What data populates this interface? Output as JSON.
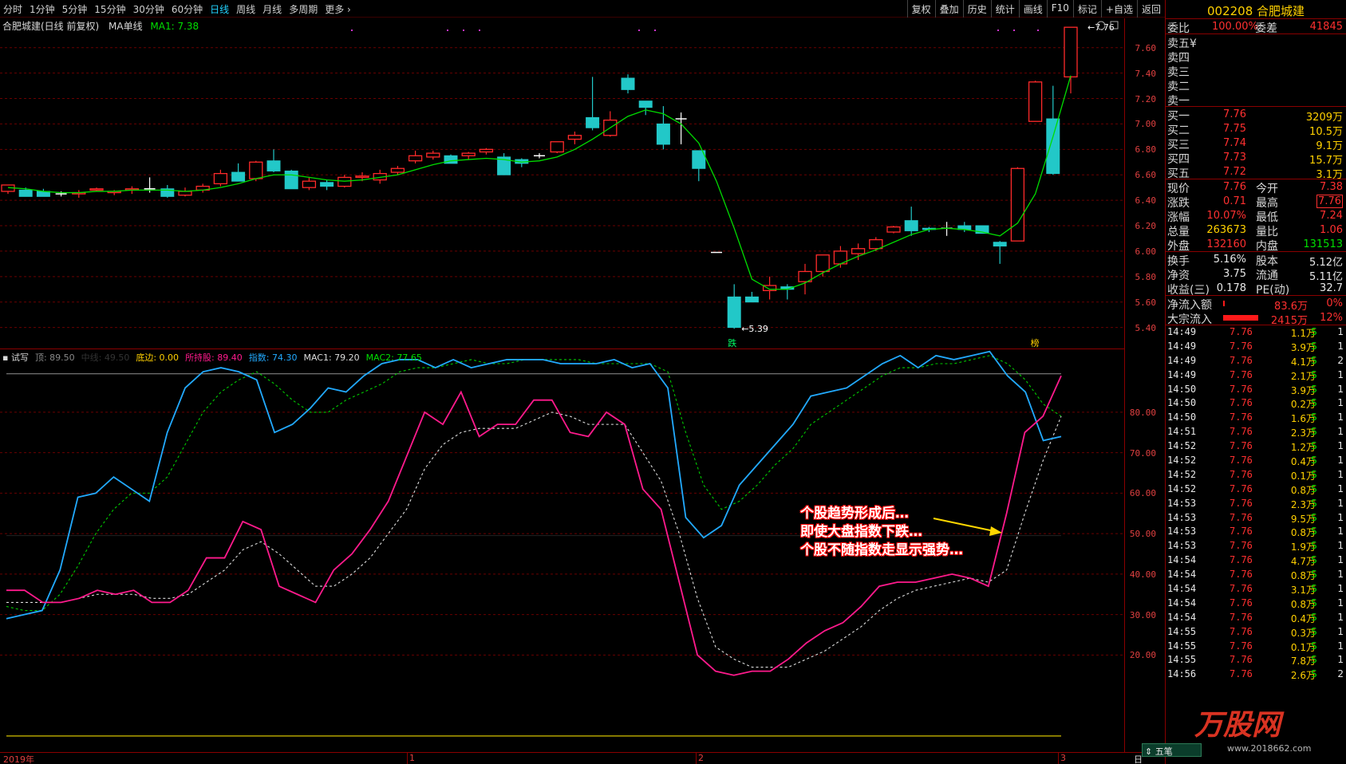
{
  "toolbar": {
    "periods": [
      "分时",
      "1分钟",
      "5分钟",
      "15分钟",
      "30分钟",
      "60分钟",
      "日线",
      "周线",
      "月线",
      "多周期",
      "更多"
    ],
    "active_period": "日线",
    "tools": [
      "复权",
      "叠加",
      "历史",
      "统计",
      "画线",
      "F10",
      "标记",
      "+自选",
      "返回"
    ]
  },
  "main_chart": {
    "title": "合肥城建(日线 前复权)",
    "indicator_name": "MA单线",
    "ma_label": "MA1: 7.38",
    "y_ticks": [
      "7.60",
      "7.40",
      "7.20",
      "7.00",
      "6.80",
      "6.60",
      "6.40",
      "6.20",
      "6.00",
      "5.80",
      "5.60",
      "5.40"
    ],
    "high_marker": "7.76",
    "low_marker": "5.39",
    "tag_die": "跌",
    "tag_bang": "榜"
  },
  "chart_data": {
    "type": "candlestick",
    "ylim": [
      5.36,
      7.78
    ],
    "ohlc": [
      [
        6.47,
        6.52,
        6.45,
        6.52
      ],
      [
        6.48,
        6.5,
        6.43,
        6.43
      ],
      [
        6.47,
        6.49,
        6.43,
        6.43
      ],
      [
        6.45,
        6.47,
        6.43,
        6.45
      ],
      [
        6.45,
        6.48,
        6.42,
        6.46
      ],
      [
        6.48,
        6.5,
        6.47,
        6.49
      ],
      [
        6.46,
        6.48,
        6.44,
        6.47
      ],
      [
        6.48,
        6.51,
        6.45,
        6.49
      ],
      [
        6.49,
        6.58,
        6.46,
        6.49
      ],
      [
        6.49,
        6.52,
        6.42,
        6.43
      ],
      [
        6.44,
        6.5,
        6.43,
        6.47
      ],
      [
        6.48,
        6.53,
        6.46,
        6.51
      ],
      [
        6.53,
        6.64,
        6.51,
        6.61
      ],
      [
        6.62,
        6.69,
        6.55,
        6.55
      ],
      [
        6.57,
        6.71,
        6.55,
        6.7
      ],
      [
        6.71,
        6.8,
        6.62,
        6.63
      ],
      [
        6.63,
        6.64,
        6.49,
        6.49
      ],
      [
        6.5,
        6.58,
        6.48,
        6.55
      ],
      [
        6.54,
        6.56,
        6.48,
        6.51
      ],
      [
        6.51,
        6.6,
        6.5,
        6.58
      ],
      [
        6.58,
        6.62,
        6.55,
        6.59
      ],
      [
        6.56,
        6.64,
        6.53,
        6.61
      ],
      [
        6.62,
        6.67,
        6.6,
        6.65
      ],
      [
        6.71,
        6.79,
        6.69,
        6.75
      ],
      [
        6.74,
        6.79,
        6.72,
        6.77
      ],
      [
        6.75,
        6.76,
        6.69,
        6.69
      ],
      [
        6.75,
        6.78,
        6.72,
        6.77
      ],
      [
        6.78,
        6.81,
        6.76,
        6.8
      ],
      [
        6.74,
        6.77,
        6.6,
        6.6
      ],
      [
        6.72,
        6.73,
        6.66,
        6.69
      ],
      [
        6.75,
        6.77,
        6.73,
        6.75
      ],
      [
        6.78,
        6.86,
        6.77,
        6.86
      ],
      [
        6.88,
        6.94,
        6.84,
        6.91
      ],
      [
        7.05,
        7.37,
        6.95,
        6.97
      ],
      [
        6.91,
        7.1,
        6.9,
        7.03
      ],
      [
        7.36,
        7.39,
        7.24,
        7.27
      ],
      [
        7.18,
        7.17,
        7.07,
        7.13
      ],
      [
        7.0,
        7.14,
        6.8,
        6.84
      ],
      [
        7.04,
        7.09,
        6.84,
        7.04
      ],
      [
        6.79,
        6.79,
        6.55,
        6.65
      ],
      [
        5.99,
        5.99,
        5.99,
        5.99
      ],
      [
        5.64,
        5.74,
        5.39,
        5.4
      ],
      [
        5.64,
        5.68,
        5.61,
        5.6
      ],
      [
        5.69,
        5.8,
        5.62,
        5.73
      ],
      [
        5.72,
        5.74,
        5.62,
        5.7
      ],
      [
        5.76,
        5.9,
        5.66,
        5.84
      ],
      [
        5.84,
        5.94,
        5.8,
        5.97
      ],
      [
        5.9,
        6.04,
        5.87,
        6.0
      ],
      [
        5.98,
        6.06,
        5.93,
        6.02
      ],
      [
        6.02,
        6.11,
        6.0,
        6.09
      ],
      [
        6.15,
        6.2,
        6.14,
        6.19
      ],
      [
        6.24,
        6.35,
        6.12,
        6.16
      ],
      [
        6.18,
        6.19,
        6.15,
        6.17
      ],
      [
        6.18,
        6.23,
        6.12,
        6.18
      ],
      [
        6.2,
        6.23,
        6.15,
        6.17
      ],
      [
        6.2,
        6.2,
        6.14,
        6.14
      ],
      [
        6.07,
        6.08,
        5.9,
        6.04
      ],
      [
        6.08,
        6.66,
        6.08,
        6.65
      ],
      [
        7.02,
        7.34,
        7.02,
        7.33
      ],
      [
        7.04,
        7.3,
        6.6,
        6.61
      ],
      [
        7.37,
        7.76,
        7.24,
        7.76
      ]
    ],
    "ma": [
      6.5,
      6.49,
      6.47,
      6.46,
      6.46,
      6.47,
      6.47,
      6.48,
      6.48,
      6.48,
      6.47,
      6.48,
      6.5,
      6.53,
      6.57,
      6.6,
      6.6,
      6.58,
      6.56,
      6.55,
      6.56,
      6.58,
      6.6,
      6.64,
      6.68,
      6.71,
      6.72,
      6.73,
      6.72,
      6.7,
      6.71,
      6.74,
      6.8,
      6.88,
      6.97,
      7.06,
      7.11,
      7.08,
      7.0,
      6.85,
      6.55,
      6.18,
      5.78,
      5.7,
      5.7,
      5.75,
      5.83,
      5.9,
      5.96,
      6.01,
      6.07,
      6.13,
      6.17,
      6.18,
      6.17,
      6.15,
      6.12,
      6.22,
      6.45,
      6.9,
      7.38
    ]
  },
  "indicator": {
    "name": "试写",
    "items": [
      {
        "label": "顶: 89.50",
        "color": "#888888"
      },
      {
        "label": "中线: 49.50",
        "color": "#333333"
      },
      {
        "label": "底边: 0.00",
        "color": "#ffd000"
      },
      {
        "label": "所持股: 89.40",
        "color": "#ff1a8c"
      },
      {
        "label": "指数: 74.30",
        "color": "#22aaff"
      },
      {
        "label": "MAC1: 79.20",
        "color": "#dddddd"
      },
      {
        "label": "MAC2: 77.65",
        "color": "#00e000"
      }
    ],
    "y_ticks": [
      "80.00",
      "70.00",
      "60.00",
      "50.00",
      "40.00",
      "30.00",
      "20.00"
    ],
    "ylim": [
      -2,
      92
    ],
    "series_stock": [
      36,
      36,
      33,
      33,
      34,
      36,
      35,
      36,
      33,
      33,
      36,
      44,
      44,
      53,
      51,
      37,
      35,
      33,
      41,
      45,
      51,
      58,
      69,
      80,
      77,
      85,
      74,
      77,
      77,
      83,
      83,
      75,
      74,
      80,
      77,
      61,
      56,
      38,
      20,
      16,
      15,
      16,
      16,
      19,
      23,
      26,
      28,
      32,
      37,
      38,
      38,
      39,
      40,
      39,
      37,
      55,
      75,
      79,
      89
    ],
    "series_stock_ma": [
      33,
      33,
      33,
      33,
      34,
      35,
      35,
      35,
      34,
      34,
      35,
      38,
      41,
      46,
      48,
      45,
      41,
      37,
      37,
      40,
      44,
      50,
      56,
      66,
      72,
      75,
      76,
      76,
      76,
      78,
      80,
      79,
      77,
      77,
      77,
      70,
      63,
      50,
      34,
      22,
      19,
      17,
      17,
      17,
      19,
      21,
      24,
      27,
      31,
      34,
      36,
      37,
      38,
      39,
      38,
      41,
      55,
      68,
      79
    ],
    "series_index": [
      29,
      30,
      31,
      41,
      59,
      60,
      64,
      61,
      58,
      75,
      86,
      90,
      91,
      90,
      88,
      75,
      77,
      81,
      86,
      85,
      89,
      92,
      93,
      93,
      91,
      93,
      91,
      92,
      93,
      93,
      93,
      92,
      92,
      92,
      93,
      91,
      92,
      86,
      54,
      49,
      52,
      62,
      67,
      72,
      77,
      84,
      85,
      86,
      89,
      92,
      94,
      91,
      94,
      93,
      94,
      95,
      89,
      85,
      73,
      74
    ],
    "series_index_ma": [
      32,
      31,
      31,
      35,
      42,
      50,
      56,
      60,
      60,
      64,
      72,
      80,
      85,
      88,
      90,
      87,
      83,
      80,
      80,
      83,
      85,
      87,
      90,
      91,
      91,
      92,
      93,
      92,
      92,
      93,
      93,
      93,
      93,
      92,
      92,
      92,
      92,
      90,
      75,
      62,
      56,
      58,
      62,
      67,
      71,
      77,
      80,
      83,
      86,
      89,
      91,
      91,
      92,
      92,
      93,
      94,
      92,
      88,
      82,
      79
    ],
    "annotation": [
      "个股趋势形成后…",
      "即使大盘指数下跌…",
      "个股不随指数走显示强势…"
    ]
  },
  "date_axis": {
    "labels": [
      "2019年",
      "1",
      "2",
      "3"
    ],
    "right_label": "日"
  },
  "quote": {
    "code_name": "002208 合肥城建",
    "wei_bi_label": "委比",
    "wei_bi": "100.00%",
    "wei_cha_label": "委差",
    "wei_cha": "41845",
    "sell_labels": [
      "卖五",
      "卖四",
      "卖三",
      "卖二",
      "卖一"
    ],
    "sell_five_mark": "¥",
    "buys": [
      {
        "label": "买一",
        "price": "7.76",
        "vol": "3209万"
      },
      {
        "label": "买二",
        "price": "7.75",
        "vol": "10.5万"
      },
      {
        "label": "买三",
        "price": "7.74",
        "vol": "9.1万"
      },
      {
        "label": "买四",
        "price": "7.73",
        "vol": "15.7万"
      },
      {
        "label": "买五",
        "price": "7.72",
        "vol": "3.1万"
      }
    ],
    "stats": [
      {
        "l1": "现价",
        "v1": "7.76",
        "c1": "red",
        "l2": "今开",
        "v2": "7.38",
        "c2": "red"
      },
      {
        "l1": "涨跌",
        "v1": "0.71",
        "c1": "red",
        "l2": "最高",
        "v2": "7.76",
        "c2": "red"
      },
      {
        "l1": "涨幅",
        "v1": "10.07%",
        "c1": "red",
        "l2": "最低",
        "v2": "7.24",
        "c2": "red"
      },
      {
        "l1": "总量",
        "v1": "263673",
        "c1": "yellow",
        "l2": "量比",
        "v2": "1.06",
        "c2": "red"
      },
      {
        "l1": "外盘",
        "v1": "132160",
        "c1": "red",
        "l2": "内盘",
        "v2": "131513",
        "c2": "green"
      }
    ],
    "stats2": [
      {
        "l1": "换手",
        "v1": "5.16%",
        "l2": "股本",
        "v2": "5.12亿"
      },
      {
        "l1": "净资",
        "v1": "3.75",
        "l2": "流通",
        "v2": "5.11亿"
      },
      {
        "l1": "收益(三)",
        "v1": "0.178",
        "l2": "PE(动)",
        "v2": "32.7"
      }
    ],
    "flows": [
      {
        "label": "净流入额",
        "value": "83.6万",
        "pct": "0%",
        "bar": 0.02
      },
      {
        "label": "大宗流入",
        "value": "2415万",
        "pct": "12%",
        "bar": 1
      }
    ]
  },
  "ticks": [
    {
      "time": "14:49",
      "price": "7.76",
      "vol": "1.1万",
      "flag": "S",
      "cnt": "1"
    },
    {
      "time": "14:49",
      "price": "7.76",
      "vol": "3.9万",
      "flag": "S",
      "cnt": "1"
    },
    {
      "time": "14:49",
      "price": "7.76",
      "vol": "4.1万",
      "flag": "S",
      "cnt": "2"
    },
    {
      "time": "14:49",
      "price": "7.76",
      "vol": "2.1万",
      "flag": "S",
      "cnt": "1"
    },
    {
      "time": "14:50",
      "price": "7.76",
      "vol": "3.9万",
      "flag": "S",
      "cnt": "1"
    },
    {
      "time": "14:50",
      "price": "7.76",
      "vol": "0.2万",
      "flag": "S",
      "cnt": "1"
    },
    {
      "time": "14:50",
      "price": "7.76",
      "vol": "1.6万",
      "flag": "S",
      "cnt": "1"
    },
    {
      "time": "14:51",
      "price": "7.76",
      "vol": "2.3万",
      "flag": "S",
      "cnt": "1"
    },
    {
      "time": "14:52",
      "price": "7.76",
      "vol": "1.2万",
      "flag": "S",
      "cnt": "1"
    },
    {
      "time": "14:52",
      "price": "7.76",
      "vol": "0.4万",
      "flag": "S",
      "cnt": "1"
    },
    {
      "time": "14:52",
      "price": "7.76",
      "vol": "0.1万",
      "flag": "S",
      "cnt": "1"
    },
    {
      "time": "14:52",
      "price": "7.76",
      "vol": "0.8万",
      "flag": "S",
      "cnt": "1"
    },
    {
      "time": "14:53",
      "price": "7.76",
      "vol": "2.3万",
      "flag": "S",
      "cnt": "1"
    },
    {
      "time": "14:53",
      "price": "7.76",
      "vol": "9.5万",
      "flag": "S",
      "cnt": "1"
    },
    {
      "time": "14:53",
      "price": "7.76",
      "vol": "0.8万",
      "flag": "S",
      "cnt": "1"
    },
    {
      "time": "14:53",
      "price": "7.76",
      "vol": "1.9万",
      "flag": "S",
      "cnt": "1"
    },
    {
      "time": "14:54",
      "price": "7.76",
      "vol": "4.7万",
      "flag": "S",
      "cnt": "1"
    },
    {
      "time": "14:54",
      "price": "7.76",
      "vol": "0.8万",
      "flag": "S",
      "cnt": "1"
    },
    {
      "time": "14:54",
      "price": "7.76",
      "vol": "3.1万",
      "flag": "S",
      "cnt": "1"
    },
    {
      "time": "14:54",
      "price": "7.76",
      "vol": "0.8万",
      "flag": "S",
      "cnt": "1"
    },
    {
      "time": "14:54",
      "price": "7.76",
      "vol": "0.4万",
      "flag": "S",
      "cnt": "1"
    },
    {
      "time": "14:55",
      "price": "7.76",
      "vol": "0.3万",
      "flag": "S",
      "cnt": "1"
    },
    {
      "time": "14:55",
      "price": "7.76",
      "vol": "0.1万",
      "flag": "S",
      "cnt": "1"
    },
    {
      "time": "14:55",
      "price": "7.76",
      "vol": "7.8万",
      "flag": "S",
      "cnt": "1"
    },
    {
      "time": "14:56",
      "price": "7.76",
      "vol": "2.6万",
      "flag": "S",
      "cnt": "2"
    }
  ],
  "footer": {
    "wubi_label": "五笔",
    "watermark": "万股网",
    "watermark_url": "www.2018662.com"
  }
}
